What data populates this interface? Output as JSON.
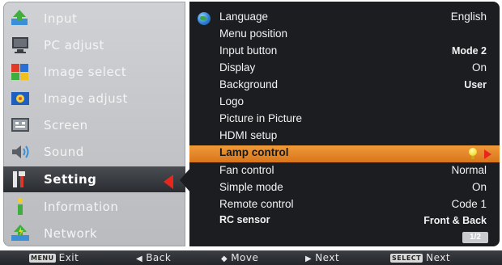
{
  "menu": {
    "items": [
      {
        "label": "Input",
        "icon": "input-icon"
      },
      {
        "label": "PC adjust",
        "icon": "pc-adjust-icon"
      },
      {
        "label": "Image select",
        "icon": "image-select-icon"
      },
      {
        "label": "Image adjust",
        "icon": "image-adjust-icon"
      },
      {
        "label": "Screen",
        "icon": "screen-icon"
      },
      {
        "label": "Sound",
        "icon": "sound-icon"
      },
      {
        "label": "Setting",
        "icon": "setting-icon"
      },
      {
        "label": "Information",
        "icon": "information-icon"
      },
      {
        "label": "Network",
        "icon": "network-icon"
      }
    ],
    "selected": "Setting"
  },
  "settings": {
    "rows": [
      {
        "label": "Language",
        "value": "English"
      },
      {
        "label": "Menu position",
        "value": ""
      },
      {
        "label": "Input button",
        "value": "Mode 2"
      },
      {
        "label": "Display",
        "value": "On"
      },
      {
        "label": "Background",
        "value": "User"
      },
      {
        "label": "Logo",
        "value": ""
      },
      {
        "label": "Picture in Picture",
        "value": ""
      },
      {
        "label": "HDMI setup",
        "value": ""
      },
      {
        "label": "Lamp control",
        "value": ""
      },
      {
        "label": "Fan control",
        "value": "Normal"
      },
      {
        "label": "Simple mode",
        "value": "On"
      },
      {
        "label": "Remote control",
        "value": "Code 1"
      },
      {
        "label": "RC sensor",
        "value": "Front & Back"
      }
    ],
    "highlighted": "Lamp control",
    "page": "1/2"
  },
  "footer": {
    "exit_key": "MENU",
    "exit_label": "Exit",
    "back_label": "Back",
    "move_label": "Move",
    "next_label": "Next",
    "select_key": "SELECT",
    "select_next_label": "Next"
  },
  "colors": {
    "highlight": "#e8862a",
    "selection_arrow": "#e8271c",
    "panel_dark": "#1b1d20",
    "panel_light": "#c4c6c9"
  }
}
